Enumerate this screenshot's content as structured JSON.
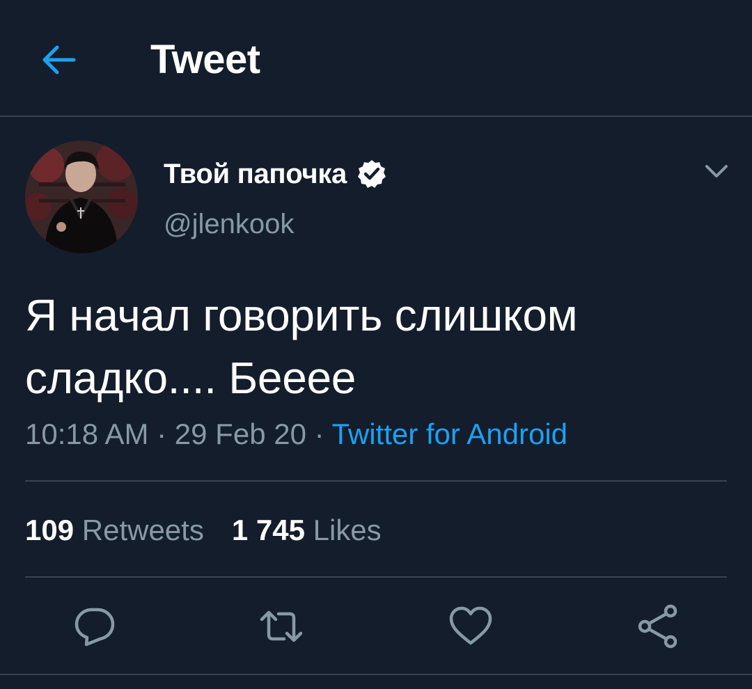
{
  "header": {
    "title": "Tweet",
    "back_icon": "arrow-left-icon"
  },
  "tweet": {
    "display_name": "Твой папочка",
    "handle": "@jlenkook",
    "verified": true,
    "text_line1": "Я начал говорить слишком",
    "text_line2": "сладко.... Бееее",
    "time": "10:18 AM",
    "separator": " · ",
    "date": "29 Feb 20",
    "source": "Twitter for Android"
  },
  "stats": {
    "retweets_count": "109",
    "retweets_label": "Retweets",
    "likes_count": "1 745",
    "likes_label": "Likes"
  },
  "actions": [
    {
      "icon": "reply-icon"
    },
    {
      "icon": "retweet-icon"
    },
    {
      "icon": "like-icon"
    },
    {
      "icon": "share-icon"
    }
  ],
  "colors": {
    "background": "#141d2b",
    "accent": "#1da1f2",
    "muted": "#8899a6",
    "divider": "#38444d"
  }
}
